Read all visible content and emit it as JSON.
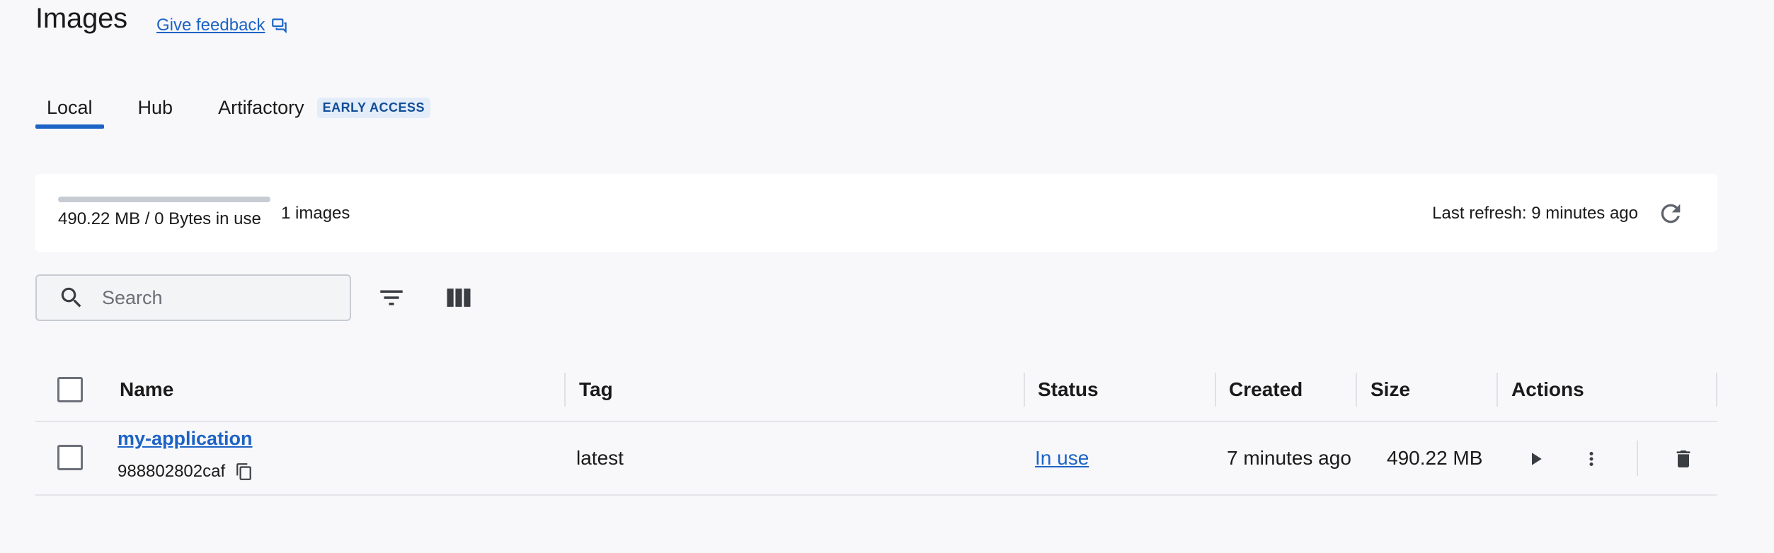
{
  "page": {
    "title": "Images",
    "feedback_label": "Give feedback"
  },
  "tabs": [
    {
      "label": "Local",
      "active": true
    },
    {
      "label": "Hub",
      "active": false
    },
    {
      "label": "Artifactory",
      "badge": "EARLY ACCESS",
      "active": false
    }
  ],
  "summary": {
    "usage_text": "490.22 MB / 0 Bytes in use",
    "usage_fraction": 0,
    "images_count": "1 images",
    "last_refresh": "Last refresh: 9 minutes ago"
  },
  "search": {
    "placeholder": "Search"
  },
  "table": {
    "columns": [
      "Name",
      "Tag",
      "Status",
      "Created",
      "Size",
      "Actions"
    ],
    "rows": [
      {
        "name": "my-application",
        "id": "988802802caf",
        "tag": "latest",
        "status": "In use",
        "created": "7 minutes ago",
        "size": "490.22 MB"
      }
    ]
  },
  "icons": {
    "feedback": "chat-bubbles-icon",
    "refresh": "refresh-icon",
    "search": "search-icon",
    "filter": "filter-icon",
    "columns": "columns-icon",
    "copy": "copy-icon",
    "run": "play-icon",
    "more": "more-vert-icon",
    "delete": "trash-icon"
  },
  "colors": {
    "accent": "#1d63c6",
    "background": "#f8f8fa",
    "badge_bg": "#e3edfa"
  }
}
